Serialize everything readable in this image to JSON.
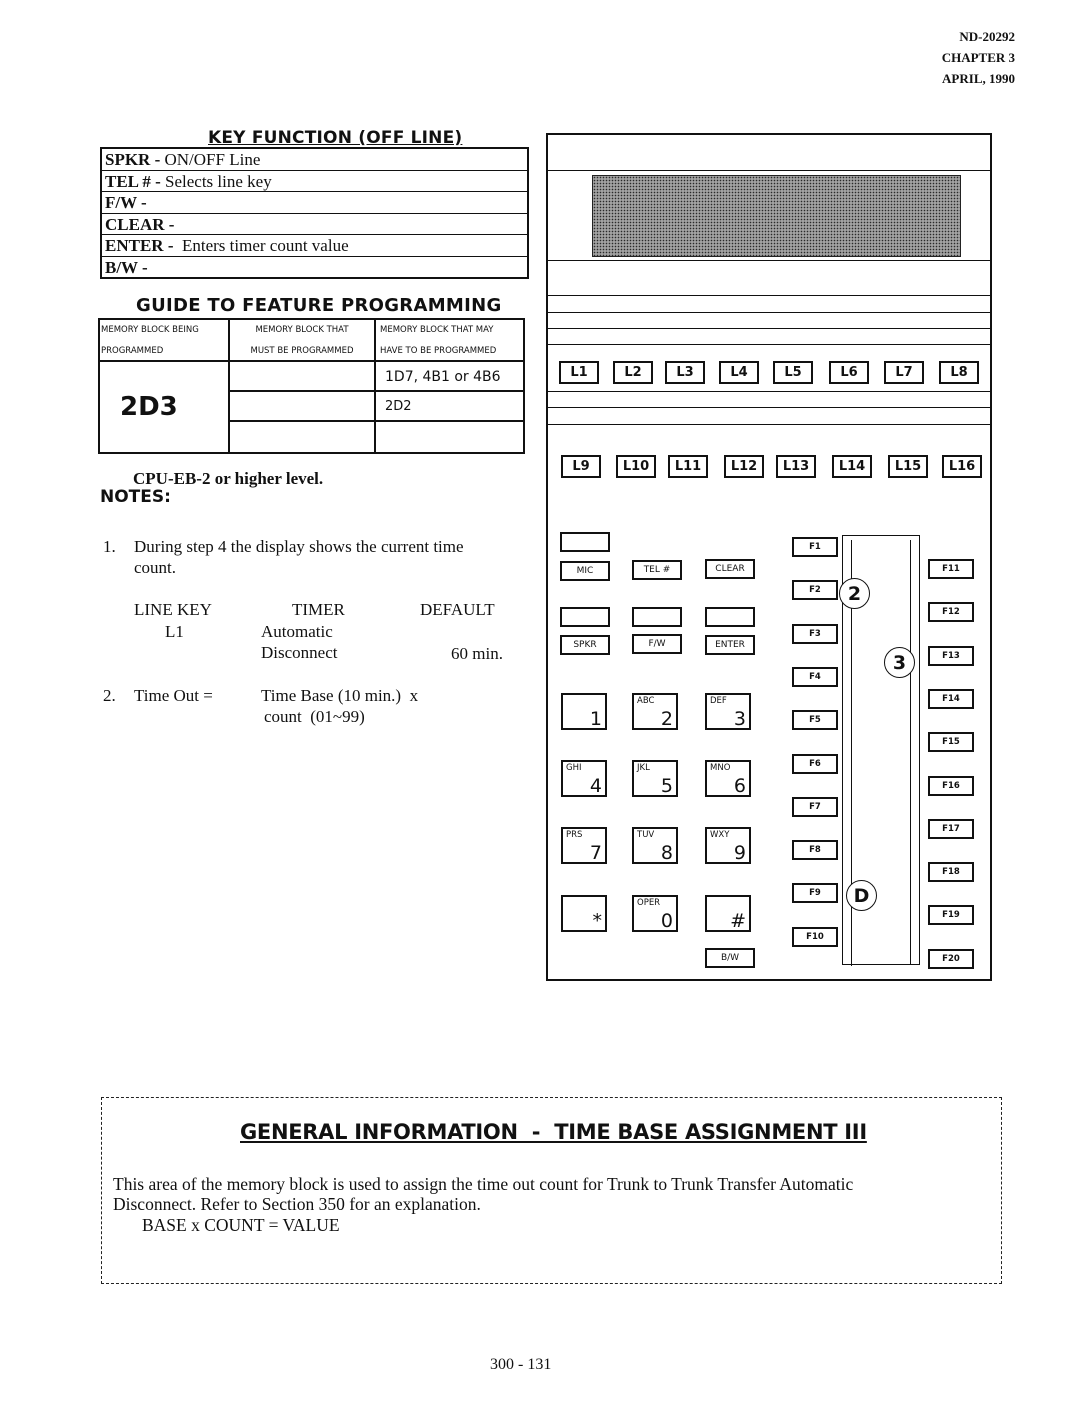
{
  "header": {
    "doc_id": "ND-20292",
    "chapter": "CHAPTER 3",
    "date": "APRIL, 1990"
  },
  "key_function": {
    "title": "KEY FUNCTION (OFF LINE)",
    "rows": [
      {
        "key": "SPKR -",
        "desc": " ON/OFF Line"
      },
      {
        "key": "TEL # -",
        "desc": " Selects line key"
      },
      {
        "key": "F/W -",
        "desc": ""
      },
      {
        "key": "CLEAR -",
        "desc": ""
      },
      {
        "key": "ENTER -",
        "desc": "  Enters timer count value"
      },
      {
        "key": "B/W -",
        "desc": ""
      }
    ]
  },
  "guide": {
    "title": "GUIDE TO FEATURE PROGRAMMING",
    "headers": [
      [
        "MEMORY BLOCK BEING",
        "PROGRAMMED"
      ],
      [
        "MEMORY BLOCK THAT",
        "MUST BE PROGRAMMED"
      ],
      [
        "MEMORY BLOCK THAT MAY",
        "HAVE TO BE PROGRAMMED"
      ]
    ],
    "block_programmed": "2D3",
    "must_be_programmed": [
      "",
      "",
      ""
    ],
    "may_have_to_be_programmed": [
      "1D7, 4B1 or 4B6",
      "2D2",
      ""
    ]
  },
  "requirement": "CPU-EB-2 or higher level.",
  "notes": {
    "title": "NOTES:",
    "note1": {
      "number": "1.",
      "text_line1": "During step 4 the display shows the current time",
      "text_line2": "count.",
      "table_headers": [
        "LINE KEY",
        "TIMER",
        "DEFAULT"
      ],
      "line_key": "L1",
      "timer_line1": "Automatic",
      "timer_line2": "Disconnect",
      "default": "60 min."
    },
    "note2": {
      "number": "2.",
      "label": "Time Out =",
      "formula_line1": "Time Base (10 min.)  x",
      "formula_line2": "count  (01~99)"
    }
  },
  "phone": {
    "line_keys_row1": [
      "L1",
      "L2",
      "L3",
      "L4",
      "L5",
      "L6",
      "L7",
      "L8"
    ],
    "line_keys_row2": [
      "L9",
      "L10",
      "L11",
      "L12",
      "L13",
      "L14",
      "L15",
      "L16"
    ],
    "soft_keys": {
      "mic": "MIC",
      "tel": "TEL #",
      "clear": "CLEAR",
      "spkr": "SPKR",
      "fw": "F/W",
      "enter": "ENTER",
      "bw": "B/W"
    },
    "dial_keys": [
      {
        "letters": "",
        "num": "1"
      },
      {
        "letters": "ABC",
        "num": "2"
      },
      {
        "letters": "DEF",
        "num": "3"
      },
      {
        "letters": "GHI",
        "num": "4"
      },
      {
        "letters": "JKL",
        "num": "5"
      },
      {
        "letters": "MNO",
        "num": "6"
      },
      {
        "letters": "PRS",
        "num": "7"
      },
      {
        "letters": "TUV",
        "num": "8"
      },
      {
        "letters": "WXY",
        "num": "9"
      },
      {
        "letters": "",
        "num": "*"
      },
      {
        "letters": "OPER",
        "num": "0"
      },
      {
        "letters": "",
        "num": "#"
      }
    ],
    "function_keys_left": [
      "F1",
      "F2",
      "F3",
      "F4",
      "F5",
      "F6",
      "F7",
      "F8",
      "F9",
      "F10"
    ],
    "function_keys_right": [
      "F11",
      "F12",
      "F13",
      "F14",
      "F15",
      "F16",
      "F17",
      "F18",
      "F19",
      "F20"
    ],
    "step_markers": {
      "step2": "2",
      "step3": "3",
      "stepD": "D"
    }
  },
  "general_info": {
    "title": "GENERAL INFORMATION  -  TIME BASE ASSIGNMENT III",
    "paragraph_line1": "This area of the memory block is used to assign the time out count for Trunk to Trunk Transfer Automatic",
    "paragraph_line2": "Disconnect.  Refer to Section 350 for an explanation.",
    "formula": "BASE x COUNT = VALUE"
  },
  "page_number": "300 - 131"
}
